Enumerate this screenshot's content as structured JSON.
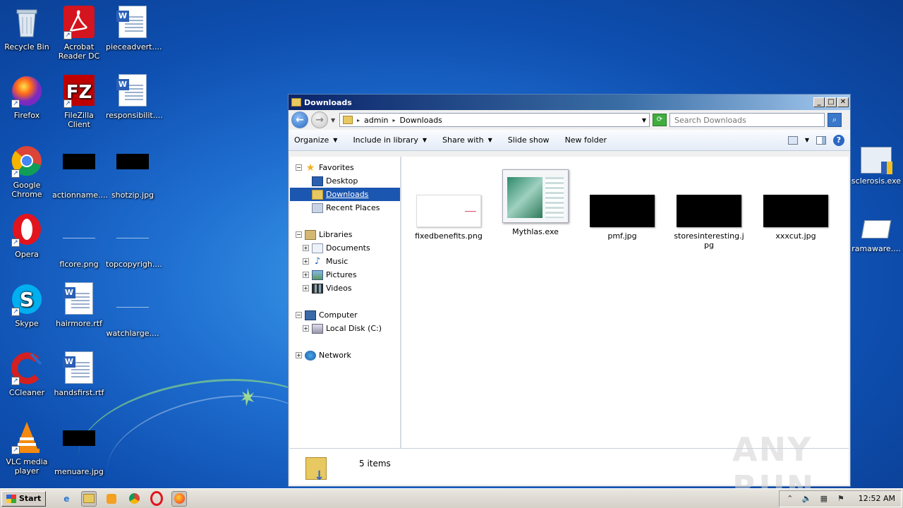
{
  "desktop": {
    "icons": [
      {
        "label": "Recycle Bin",
        "icon": "recycle-bin-icon"
      },
      {
        "label": "Acrobat Reader DC",
        "icon": "acrobat-icon"
      },
      {
        "label": "pieceadvert....",
        "icon": "word-document-icon"
      },
      {
        "label": "Firefox",
        "icon": "firefox-icon"
      },
      {
        "label": "FileZilla Client",
        "icon": "filezilla-icon"
      },
      {
        "label": "responsibilit....",
        "icon": "word-document-icon"
      },
      {
        "label": "Google Chrome",
        "icon": "chrome-icon"
      },
      {
        "label": "actionname....",
        "icon": "image-thumbnail-icon"
      },
      {
        "label": "shotzip.jpg",
        "icon": "image-thumbnail-icon"
      },
      {
        "label": "Opera",
        "icon": "opera-icon"
      },
      {
        "label": "flcore.png",
        "icon": "image-thumbnail-icon"
      },
      {
        "label": "topcopyrigh....",
        "icon": "image-thumbnail-icon"
      },
      {
        "label": "Skype",
        "icon": "skype-icon"
      },
      {
        "label": "hairmore.rtf",
        "icon": "word-document-icon"
      },
      {
        "label": "watchlarge....",
        "icon": "image-thumbnail-icon"
      },
      {
        "label": "CCleaner",
        "icon": "ccleaner-icon"
      },
      {
        "label": "handsfirst.rtf",
        "icon": "word-document-icon"
      },
      {
        "label": "VLC media player",
        "icon": "vlc-icon"
      },
      {
        "label": "menuare.jpg",
        "icon": "image-thumbnail-icon"
      }
    ],
    "right_icons": [
      {
        "label": "sclerosis.exe",
        "icon": "installer-icon"
      },
      {
        "label": "ramaware....",
        "icon": "document-icon"
      }
    ]
  },
  "window": {
    "title": "Downloads",
    "buttons": {
      "minimize": "_",
      "maximize": "□",
      "close": "✕"
    },
    "address": {
      "crumbs": [
        "admin",
        "Downloads"
      ]
    },
    "search": {
      "placeholder": "Search Downloads"
    },
    "toolbar": {
      "organize": "Organize",
      "include": "Include in library",
      "share": "Share with",
      "slideshow": "Slide show",
      "newfolder": "New folder"
    },
    "nav": {
      "favorites": "Favorites",
      "desktop": "Desktop",
      "downloads": "Downloads",
      "recent": "Recent Places",
      "libraries": "Libraries",
      "documents": "Documents",
      "music": "Music",
      "pictures": "Pictures",
      "videos": "Videos",
      "computer": "Computer",
      "localdisk": "Local Disk (C:)",
      "network": "Network"
    },
    "files": [
      {
        "name": "fixedbenefits.png"
      },
      {
        "name": "Mythlas.exe"
      },
      {
        "name": "pmf.jpg"
      },
      {
        "name": "storesinteresting.jpg"
      },
      {
        "name": "xxxcut.jpg"
      }
    ],
    "status": "5 items"
  },
  "taskbar": {
    "start": "Start",
    "clock": "12:52 AM"
  },
  "watermark": "ANY RUN",
  "colors": {
    "selection": "#1b56b0",
    "titlebar": "#0a246a"
  }
}
